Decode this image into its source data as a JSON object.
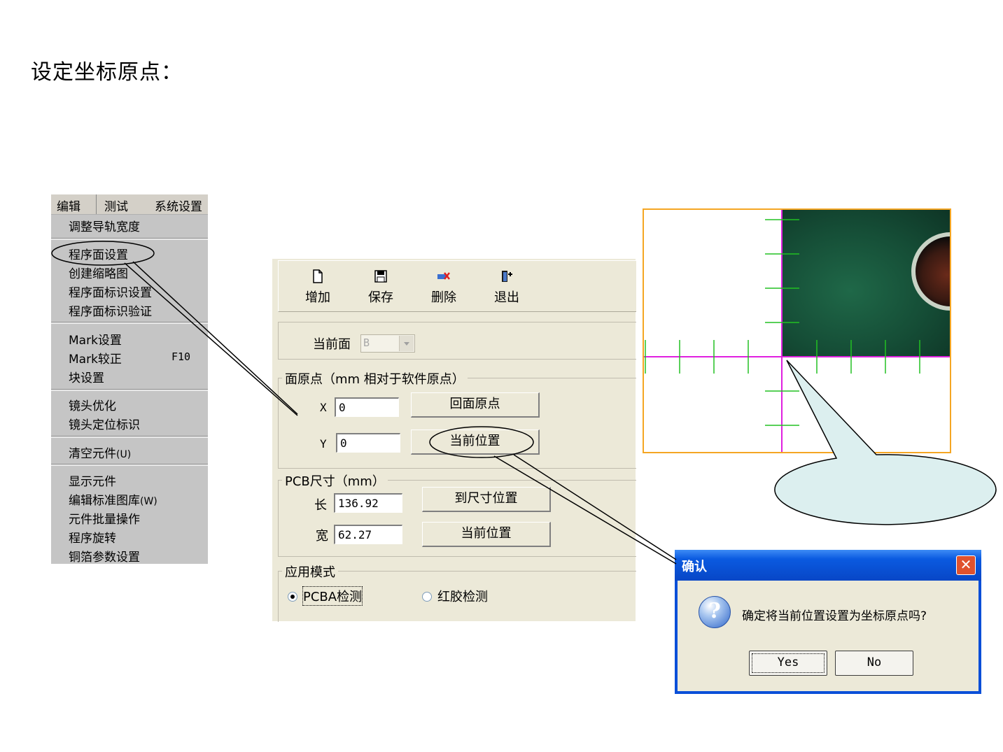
{
  "page": {
    "title": "设定坐标原点："
  },
  "menu": {
    "bar": {
      "edit": "编辑",
      "test": "测试",
      "system": "系统设置"
    },
    "items": {
      "adjust_rail": "调整导轨宽度",
      "program_face": "程序面设置",
      "create_thumbnail": "创建缩略图",
      "face_mark_setup": "程序面标识设置",
      "face_mark_verify": "程序面标识验证",
      "mark_setup": "Mark设置",
      "mark_calibrate": "Mark较正",
      "mark_calibrate_shortcut": "F10",
      "block_setup": "块设置",
      "lens_optimize": "镜头优化",
      "lens_locate_mark": "镜头定位标识",
      "clear_components": "清空元件",
      "clear_components_hotkey": "(U)",
      "show_components": "显示元件",
      "edit_std_library": "编辑标准图库",
      "edit_std_library_hotkey": "(W)",
      "batch_ops": "元件批量操作",
      "program_rotate": "程序旋转",
      "copper_params": "铜箔参数设置"
    }
  },
  "program_panel": {
    "toolbar": {
      "add": "增加",
      "save": "保存",
      "delete": "删除",
      "exit": "退出"
    },
    "current_face_label": "当前面",
    "current_face_value": "B",
    "origin_group": {
      "title": "面原点（mm 相对于软件原点）",
      "x_label": "X",
      "x_value": "0",
      "y_label": "Y",
      "y_value": "0",
      "return_origin_btn": "回面原点",
      "current_pos_btn": "当前位置"
    },
    "pcb_size_group": {
      "title": "PCB尺寸（mm）",
      "length_label": "长",
      "length_value": "136.92",
      "width_label": "宽",
      "width_value": "62.27",
      "to_size_btn": "到尺寸位置",
      "current_pos_btn": "当前位置"
    },
    "mode_group": {
      "title": "应用模式",
      "pcba_label": "PCBA检测",
      "glue_label": "红胶检测",
      "selected": "PCBA检测"
    }
  },
  "camera_view": {
    "colors": {
      "frame": "#f5a623",
      "crosshair": "#e020e0",
      "ticks": "#22c022"
    }
  },
  "dialog": {
    "title": "确认",
    "close_glyph": "✕",
    "icon_glyph": "?",
    "message": "确定将当前位置设置为坐标原点吗?",
    "yes": "Yes",
    "no": "No"
  }
}
